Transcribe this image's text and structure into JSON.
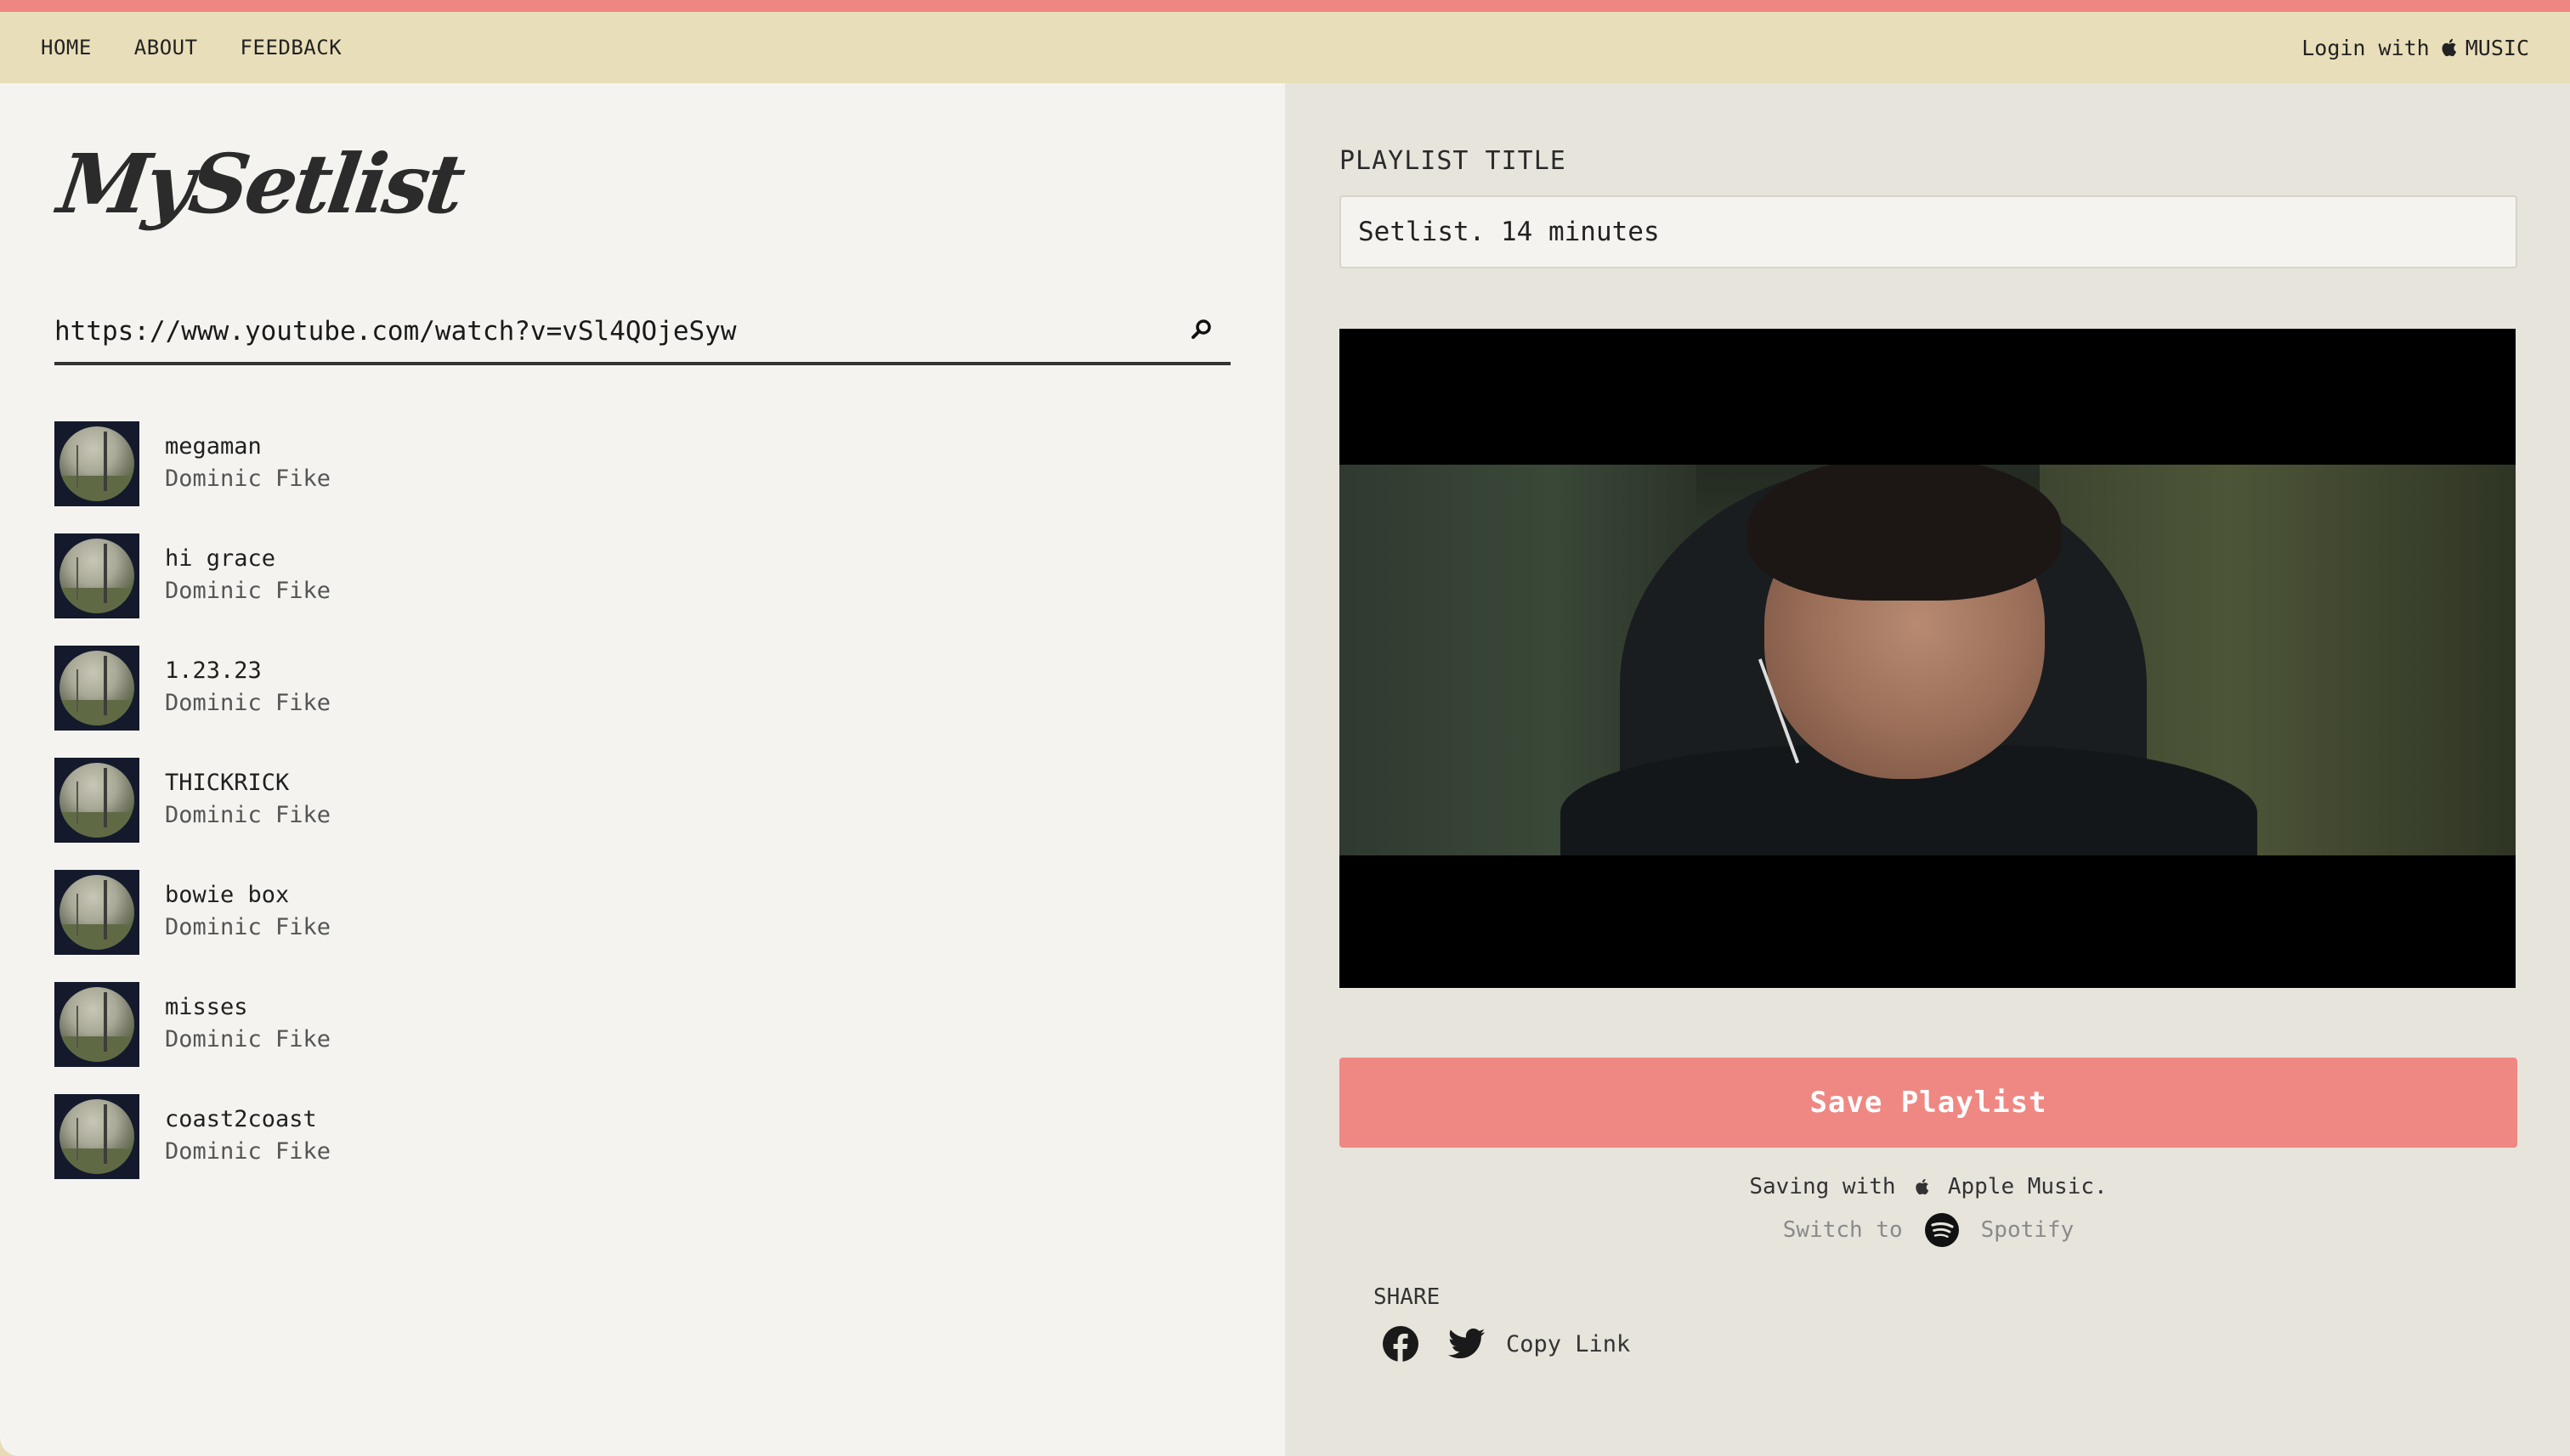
{
  "nav": {
    "home": "HOME",
    "about": "ABOUT",
    "feedback": "FEEDBACK",
    "login_prefix": "Login with",
    "login_service": "MUSIC"
  },
  "logo": "MySetlist",
  "search": {
    "value": "https://www.youtube.com/watch?v=vSl4QOjeSyw"
  },
  "tracks": [
    {
      "title": "megaman",
      "artist": "Dominic Fike"
    },
    {
      "title": "hi grace",
      "artist": "Dominic Fike"
    },
    {
      "title": "1.23.23",
      "artist": "Dominic Fike"
    },
    {
      "title": "THICKRICK",
      "artist": "Dominic Fike"
    },
    {
      "title": "bowie box",
      "artist": "Dominic Fike"
    },
    {
      "title": "misses",
      "artist": "Dominic Fike"
    },
    {
      "title": "coast2coast",
      "artist": "Dominic Fike"
    }
  ],
  "playlist": {
    "label": "PLAYLIST TITLE",
    "title_value": "Setlist. 14 minutes"
  },
  "save_button": "Save Playlist",
  "saving": {
    "prefix": "Saving with",
    "service": "Apple Music."
  },
  "switch": {
    "prefix": "Switch to",
    "service": "Spotify"
  },
  "share": {
    "label": "SHARE",
    "copy_link": "Copy Link"
  },
  "colors": {
    "accent": "#ef8883",
    "nav_bg": "#e8deb9",
    "left_bg": "#f4f3ef",
    "right_bg": "#e7e4dc"
  }
}
